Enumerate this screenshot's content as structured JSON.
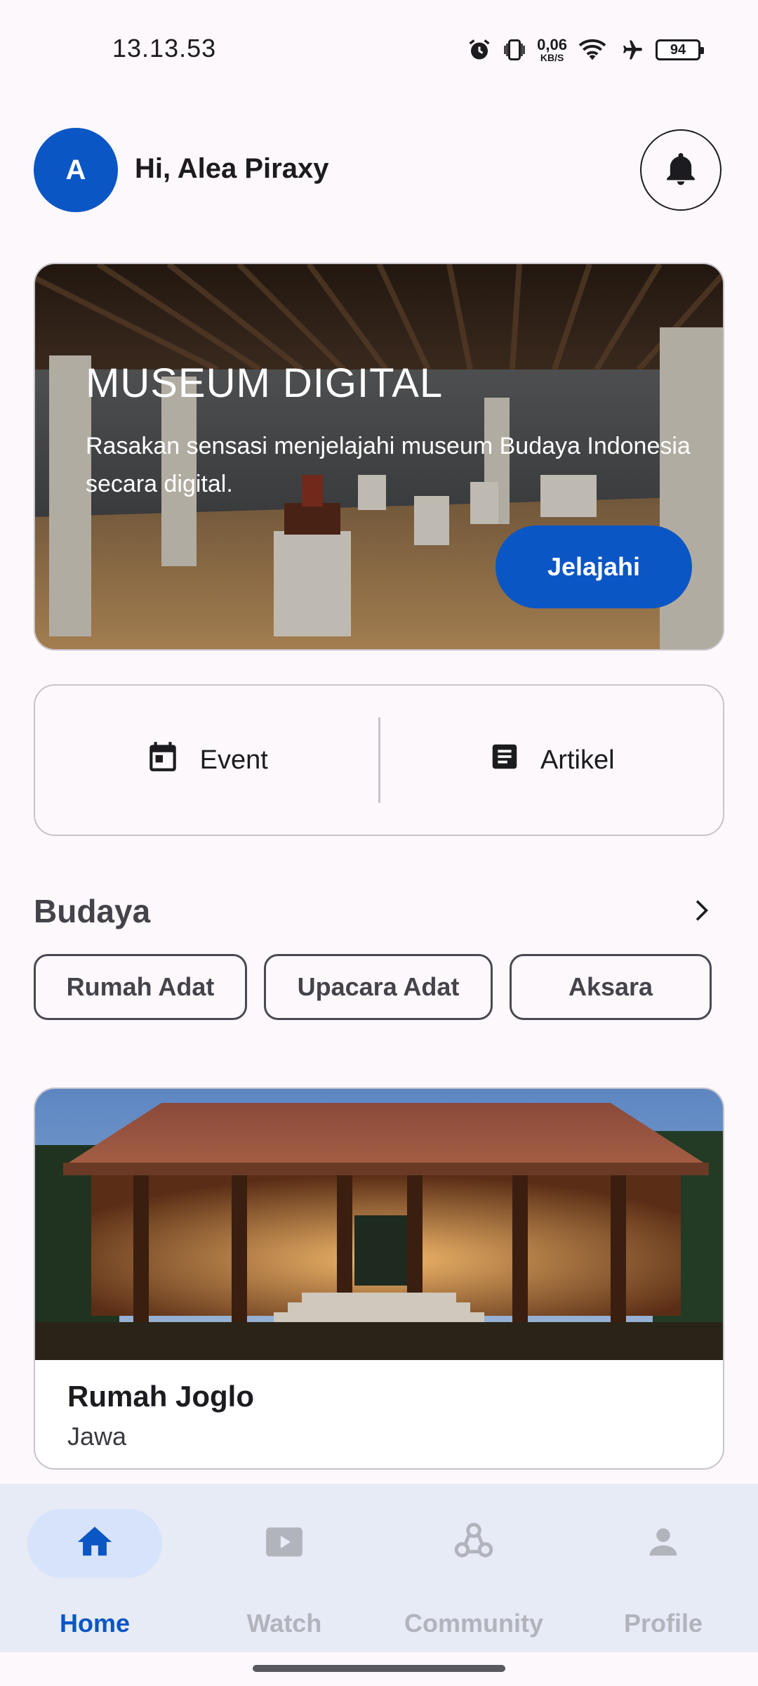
{
  "status_bar": {
    "time": "13.13.53",
    "net_speed_value": "0,06",
    "net_speed_unit": "KB/S",
    "battery": "94",
    "icons": [
      "alarm-icon",
      "vibrate-icon",
      "wifi-icon",
      "airplane-icon",
      "battery-icon"
    ]
  },
  "header": {
    "avatar_initial": "A",
    "greeting": "Hi, Alea Piraxy",
    "icon": "bell-icon"
  },
  "hero": {
    "title": "MUSEUM DIGITAL",
    "description": "Rasakan sensasi menjelajahi museum Budaya Indonesia secara digital.",
    "button_label": "Jelajahi"
  },
  "shortcuts": [
    {
      "label": "Event",
      "icon": "calendar-icon"
    },
    {
      "label": "Artikel",
      "icon": "article-icon"
    }
  ],
  "budaya": {
    "title": "Budaya",
    "chips": [
      "Rumah Adat",
      "Upacara Adat",
      "Aksara"
    ]
  },
  "featured": {
    "name": "Rumah Joglo",
    "region": "Jawa"
  },
  "bottom_nav": [
    {
      "label": "Home",
      "icon": "home-icon",
      "active": true
    },
    {
      "label": "Watch",
      "icon": "play-icon",
      "active": false
    },
    {
      "label": "Community",
      "icon": "community-icon",
      "active": false
    },
    {
      "label": "Profile",
      "icon": "person-icon",
      "active": false
    }
  ],
  "colors": {
    "primary": "#0a56c4",
    "background": "#fdf8fc",
    "nav_background": "#e6ebf6",
    "nav_inactive": "#b1b4bb"
  }
}
